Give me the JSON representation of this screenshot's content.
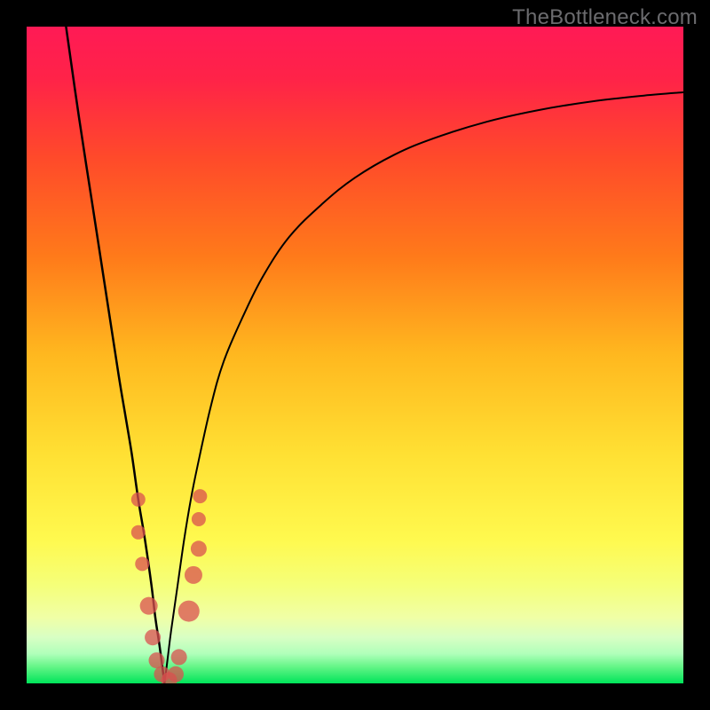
{
  "watermark": "TheBottleneck.com",
  "colors": {
    "frame": "#000000",
    "curve": "#000000",
    "marker_fill": "#d9504fbf",
    "marker_stroke": "#c84645",
    "gradient_stops": [
      {
        "offset": 0,
        "color": "#ff1a55"
      },
      {
        "offset": 0.08,
        "color": "#ff2348"
      },
      {
        "offset": 0.2,
        "color": "#ff4a2a"
      },
      {
        "offset": 0.35,
        "color": "#ff7a1a"
      },
      {
        "offset": 0.5,
        "color": "#ffb81f"
      },
      {
        "offset": 0.65,
        "color": "#ffe033"
      },
      {
        "offset": 0.78,
        "color": "#fff94e"
      },
      {
        "offset": 0.85,
        "color": "#f5ff79"
      },
      {
        "offset": 0.9,
        "color": "#f0ffa6"
      },
      {
        "offset": 0.93,
        "color": "#d8ffc4"
      },
      {
        "offset": 0.955,
        "color": "#b0ffba"
      },
      {
        "offset": 0.975,
        "color": "#63f586"
      },
      {
        "offset": 1.0,
        "color": "#00e45a"
      }
    ]
  },
  "chart_data": {
    "type": "line",
    "title": "",
    "xlabel": "",
    "ylabel": "",
    "xmin": 0,
    "xmax": 100,
    "ylim": [
      0,
      100
    ],
    "x0": 21,
    "series": [
      {
        "name": "left",
        "x": [
          6,
          8,
          10,
          12,
          14,
          15,
          16,
          17,
          18,
          19,
          19.6,
          20.2,
          20.6,
          21
        ],
        "y": [
          100,
          86,
          73,
          60,
          47,
          41,
          35,
          28,
          22,
          15,
          10,
          6,
          3,
          0
        ]
      },
      {
        "name": "right",
        "x": [
          21,
          21.5,
          22,
          23,
          24,
          25,
          26,
          28,
          30,
          33,
          36,
          40,
          45,
          50,
          56,
          62,
          70,
          78,
          86,
          94,
          100
        ],
        "y": [
          0,
          4,
          8,
          15,
          22,
          28,
          33,
          42,
          49,
          56,
          62,
          68,
          73,
          77,
          80.5,
          83,
          85.5,
          87.3,
          88.6,
          89.5,
          90
        ]
      }
    ],
    "markers": [
      {
        "x": 17,
        "y": 28,
        "r": 8
      },
      {
        "x": 17,
        "y": 23,
        "r": 8
      },
      {
        "x": 17.6,
        "y": 18.2,
        "r": 8
      },
      {
        "x": 18.6,
        "y": 11.8,
        "r": 10
      },
      {
        "x": 19.2,
        "y": 7,
        "r": 9
      },
      {
        "x": 19.8,
        "y": 3.5,
        "r": 9
      },
      {
        "x": 20.6,
        "y": 1.4,
        "r": 9
      },
      {
        "x": 21.7,
        "y": 0.5,
        "r": 9
      },
      {
        "x": 22.7,
        "y": 1.4,
        "r": 9
      },
      {
        "x": 23.2,
        "y": 4,
        "r": 9
      },
      {
        "x": 24.7,
        "y": 11,
        "r": 12
      },
      {
        "x": 25.4,
        "y": 16.5,
        "r": 10
      },
      {
        "x": 26.2,
        "y": 20.5,
        "r": 9
      },
      {
        "x": 26.2,
        "y": 25,
        "r": 8
      },
      {
        "x": 26.4,
        "y": 28.5,
        "r": 8
      }
    ]
  }
}
